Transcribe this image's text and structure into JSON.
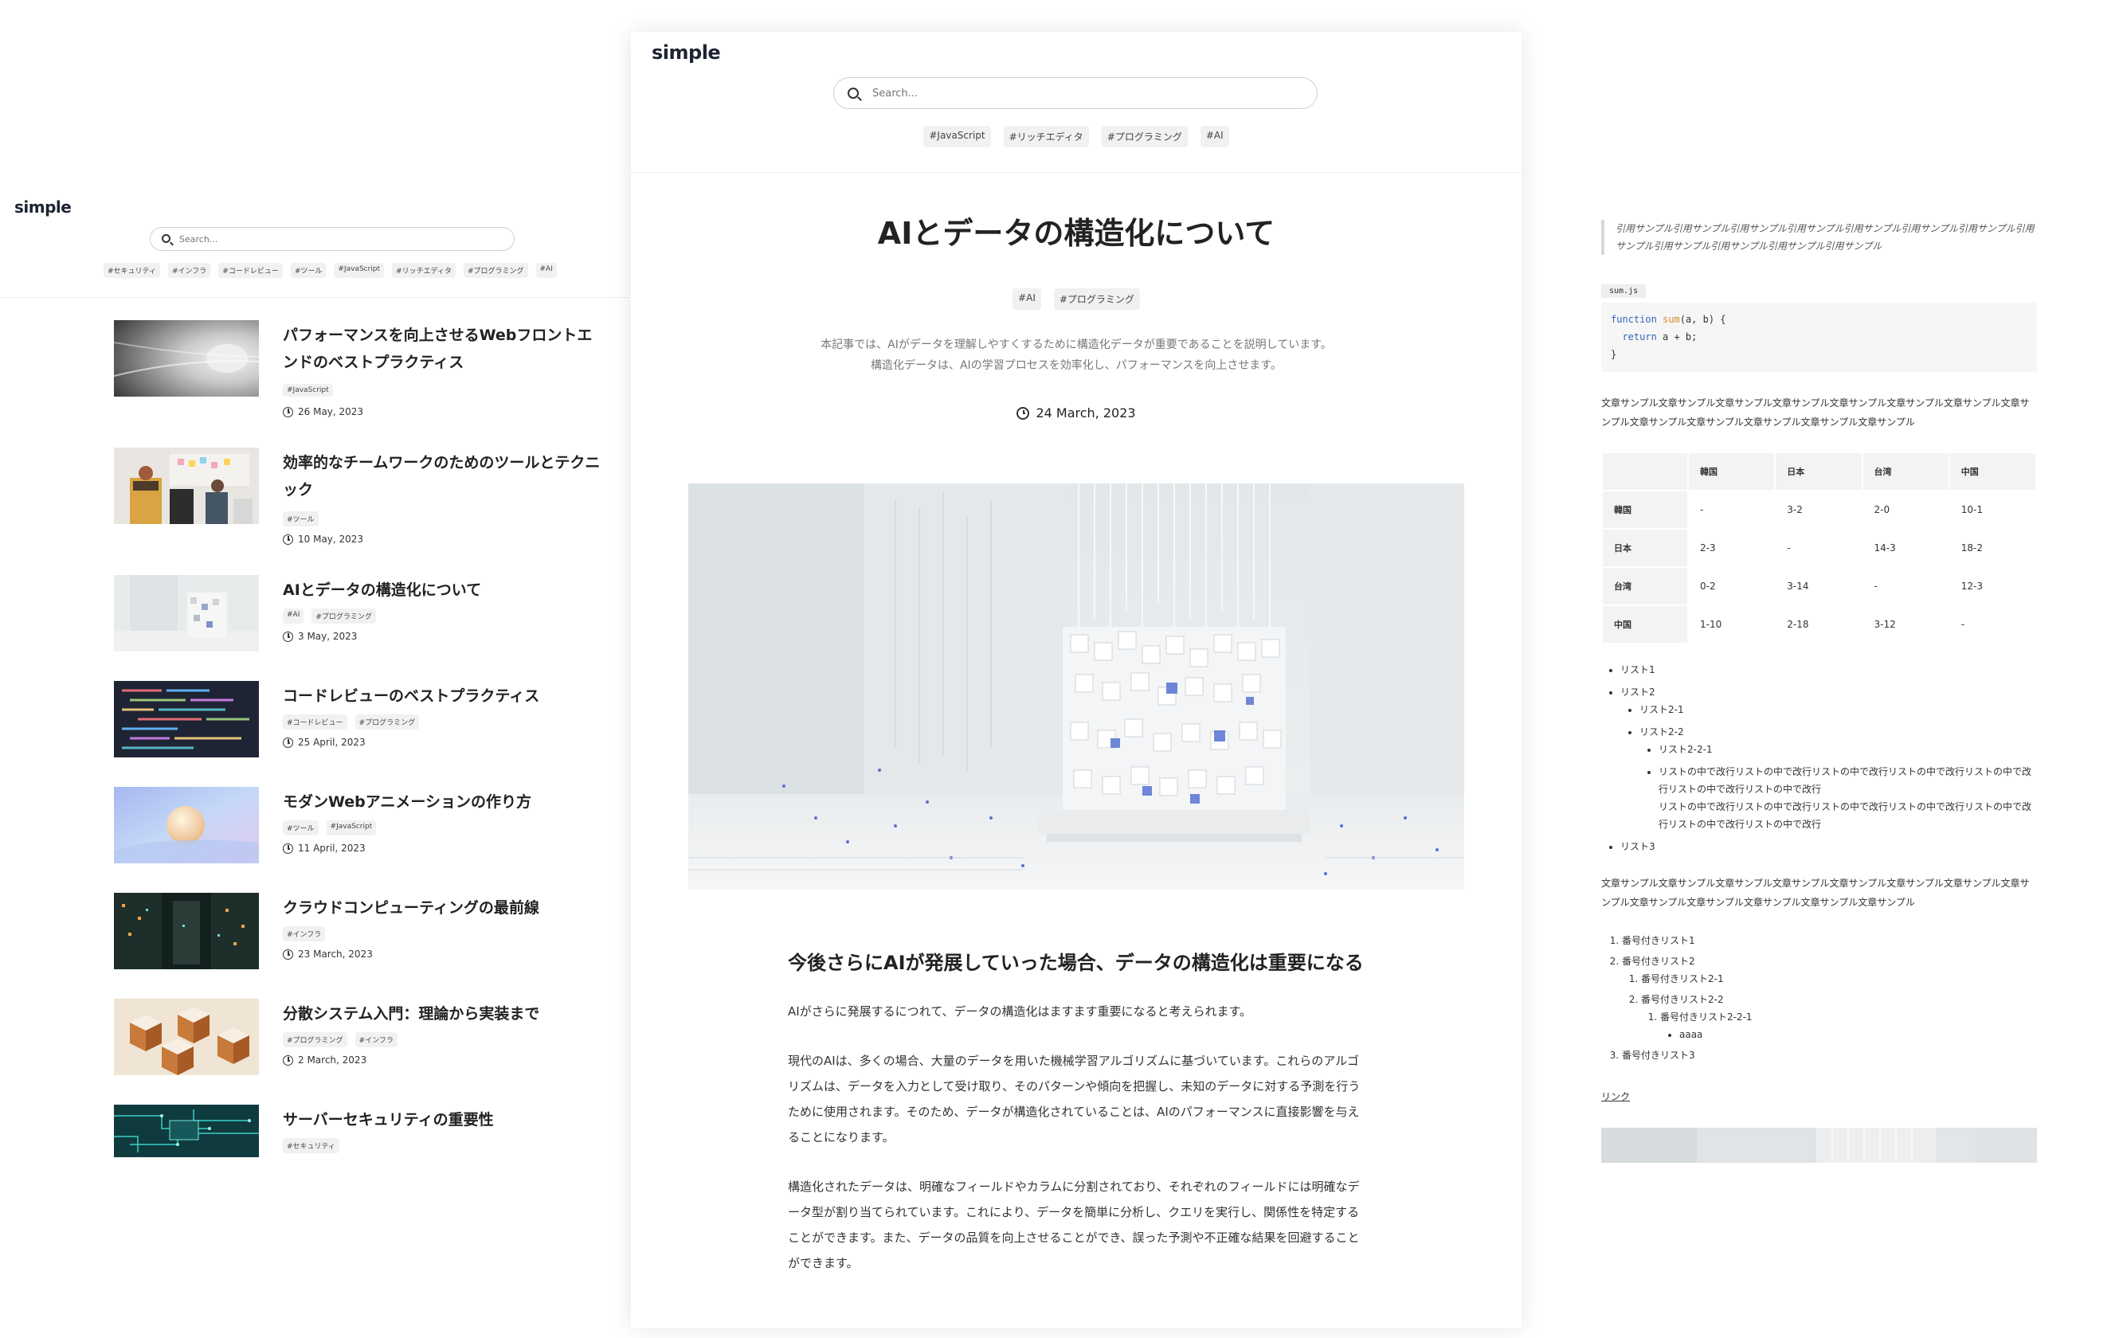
{
  "site": {
    "logo": "simple"
  },
  "search": {
    "placeholder": "Search..."
  },
  "list_view": {
    "tags": [
      "#セキュリティ",
      "#インフラ",
      "#コードレビュー",
      "#ツール",
      "#JavaScript",
      "#リッチエディタ",
      "#プログラミング",
      "#AI"
    ],
    "articles": [
      {
        "title": "パフォーマンスを向上させるWebフロントエンドのベストプラクティス",
        "tags": [
          "#JavaScript"
        ],
        "date": "26 May, 2023",
        "thumbnail": "tunnel"
      },
      {
        "title": "効率的なチームワークのためのツールとテクニック",
        "tags": [
          "#ツール"
        ],
        "date": "10 May, 2023",
        "thumbnail": "team-meeting"
      },
      {
        "title": "AIとデータの構造化について",
        "tags": [
          "#AI",
          "#プログラミング"
        ],
        "date": "3 May, 2023",
        "thumbnail": "data-cubes"
      },
      {
        "title": "コードレビューのベストプラクティス",
        "tags": [
          "#コードレビュー",
          "#プログラミング"
        ],
        "date": "25 April, 2023",
        "thumbnail": "code-screen"
      },
      {
        "title": "モダンWebアニメーションの作り方",
        "tags": [
          "#ツール",
          "#JavaScript"
        ],
        "date": "11 April, 2023",
        "thumbnail": "gradient-sphere"
      },
      {
        "title": "クラウドコンピューティングの最前線",
        "tags": [
          "#インフラ"
        ],
        "date": "23 March, 2023",
        "thumbnail": "server-room"
      },
      {
        "title": "分散システム入門：理論から実装まで",
        "tags": [
          "#プログラミング",
          "#インフラ"
        ],
        "date": "2 March, 2023",
        "thumbnail": "copper-cubes"
      },
      {
        "title": "サーバーセキュリティの重要性",
        "tags": [
          "#セキュリティ"
        ],
        "date": "",
        "thumbnail": "circuit-board"
      }
    ]
  },
  "article_view": {
    "header_tags": [
      "#JavaScript",
      "#リッチエディタ",
      "#プログラミング",
      "#AI"
    ],
    "title": "AIとデータの構造化について",
    "tags": [
      "#AI",
      "#プログラミング"
    ],
    "lead": "本記事では、AIがデータを理解しやすくするために構造化データが重要であることを説明しています。構造化データは、AIの学習プロセスを効率化し、パフォーマンスを向上させます。",
    "date": "24 March, 2023",
    "heading": "今後さらにAIが発展していった場合、データの構造化は重要になる",
    "paragraphs": [
      "AIがさらに発展するにつれて、データの構造化はますます重要になると考えられます。",
      "現代のAIは、多くの場合、大量のデータを用いた機械学習アルゴリズムに基づいています。これらのアルゴリズムは、データを入力として受け取り、そのパターンや傾向を把握し、未知のデータに対する予測を行うために使用されます。そのため、データが構造化されていることは、AIのパフォーマンスに直接影響を与えることになります。",
      "構造化されたデータは、明確なフィールドやカラムに分割されており、それぞれのフィールドには明確なデータ型が割り当てられています。これにより、データを簡単に分析し、クエリを実行し、関係性を特定することができます。また、データの品質を向上させることができ、誤った予測や不正確な結果を回避することができます。"
    ]
  },
  "detail_view": {
    "quote": "引用サンプル引用サンプル引用サンプル引用サンプル引用サンプル引用サンプル引用サンプル引用サンプル引用サンプル引用サンプル引用サンプル引用サンプル",
    "code_filename": "sum.js",
    "paragraph1": "文章サンプル文章サンプル文章サンプル文章サンプル文章サンプル文章サンプル文章サンプル文章サンプル文章サンプル文章サンプル文章サンプル文章サンプル文章サンプル",
    "table": {
      "headers": [
        "",
        "韓国",
        "日本",
        "台湾",
        "中国"
      ],
      "rows": [
        [
          "韓国",
          "-",
          "3-2",
          "2-0",
          "10-1"
        ],
        [
          "日本",
          "2-3",
          "-",
          "14-3",
          "18-2"
        ],
        [
          "台湾",
          "0-2",
          "3-14",
          "-",
          "12-3"
        ],
        [
          "中国",
          "1-10",
          "2-18",
          "3-12",
          "-"
        ]
      ]
    },
    "bullets": {
      "l1": "リスト1",
      "l2": "リスト2",
      "l2_1": "リスト2-1",
      "l2_2": "リスト2-2",
      "l2_2_1": "リスト2-2-1",
      "long1": "リストの中で改行リストの中で改行リストの中で改行リストの中で改行リストの中で改行リストの中で改行リストの中で改行",
      "long2": "リストの中で改行リストの中で改行リストの中で改行リストの中で改行リストの中で改行リストの中で改行リストの中で改行",
      "l3": "リスト3"
    },
    "paragraph2": "文章サンプル文章サンプル文章サンプル文章サンプル文章サンプル文章サンプル文章サンプル文章サンプル文章サンプル文章サンプル文章サンプル文章サンプル文章サンプル",
    "ordered": {
      "o1": "番号付きリスト1",
      "o2": "番号付きリスト2",
      "o2_1": "番号付きリスト2-1",
      "o2_2": "番号付きリスト2-2",
      "o2_2_1": "番号付きリスト2-2-1",
      "bullet": "aaaa",
      "o3": "番号付きリスト3"
    },
    "link": "リンク"
  },
  "colors": {
    "tag_bg": "#f1f1f1",
    "logo": "#1d2433",
    "code_keyword": "#3366bb",
    "code_function": "#d98a2a"
  }
}
